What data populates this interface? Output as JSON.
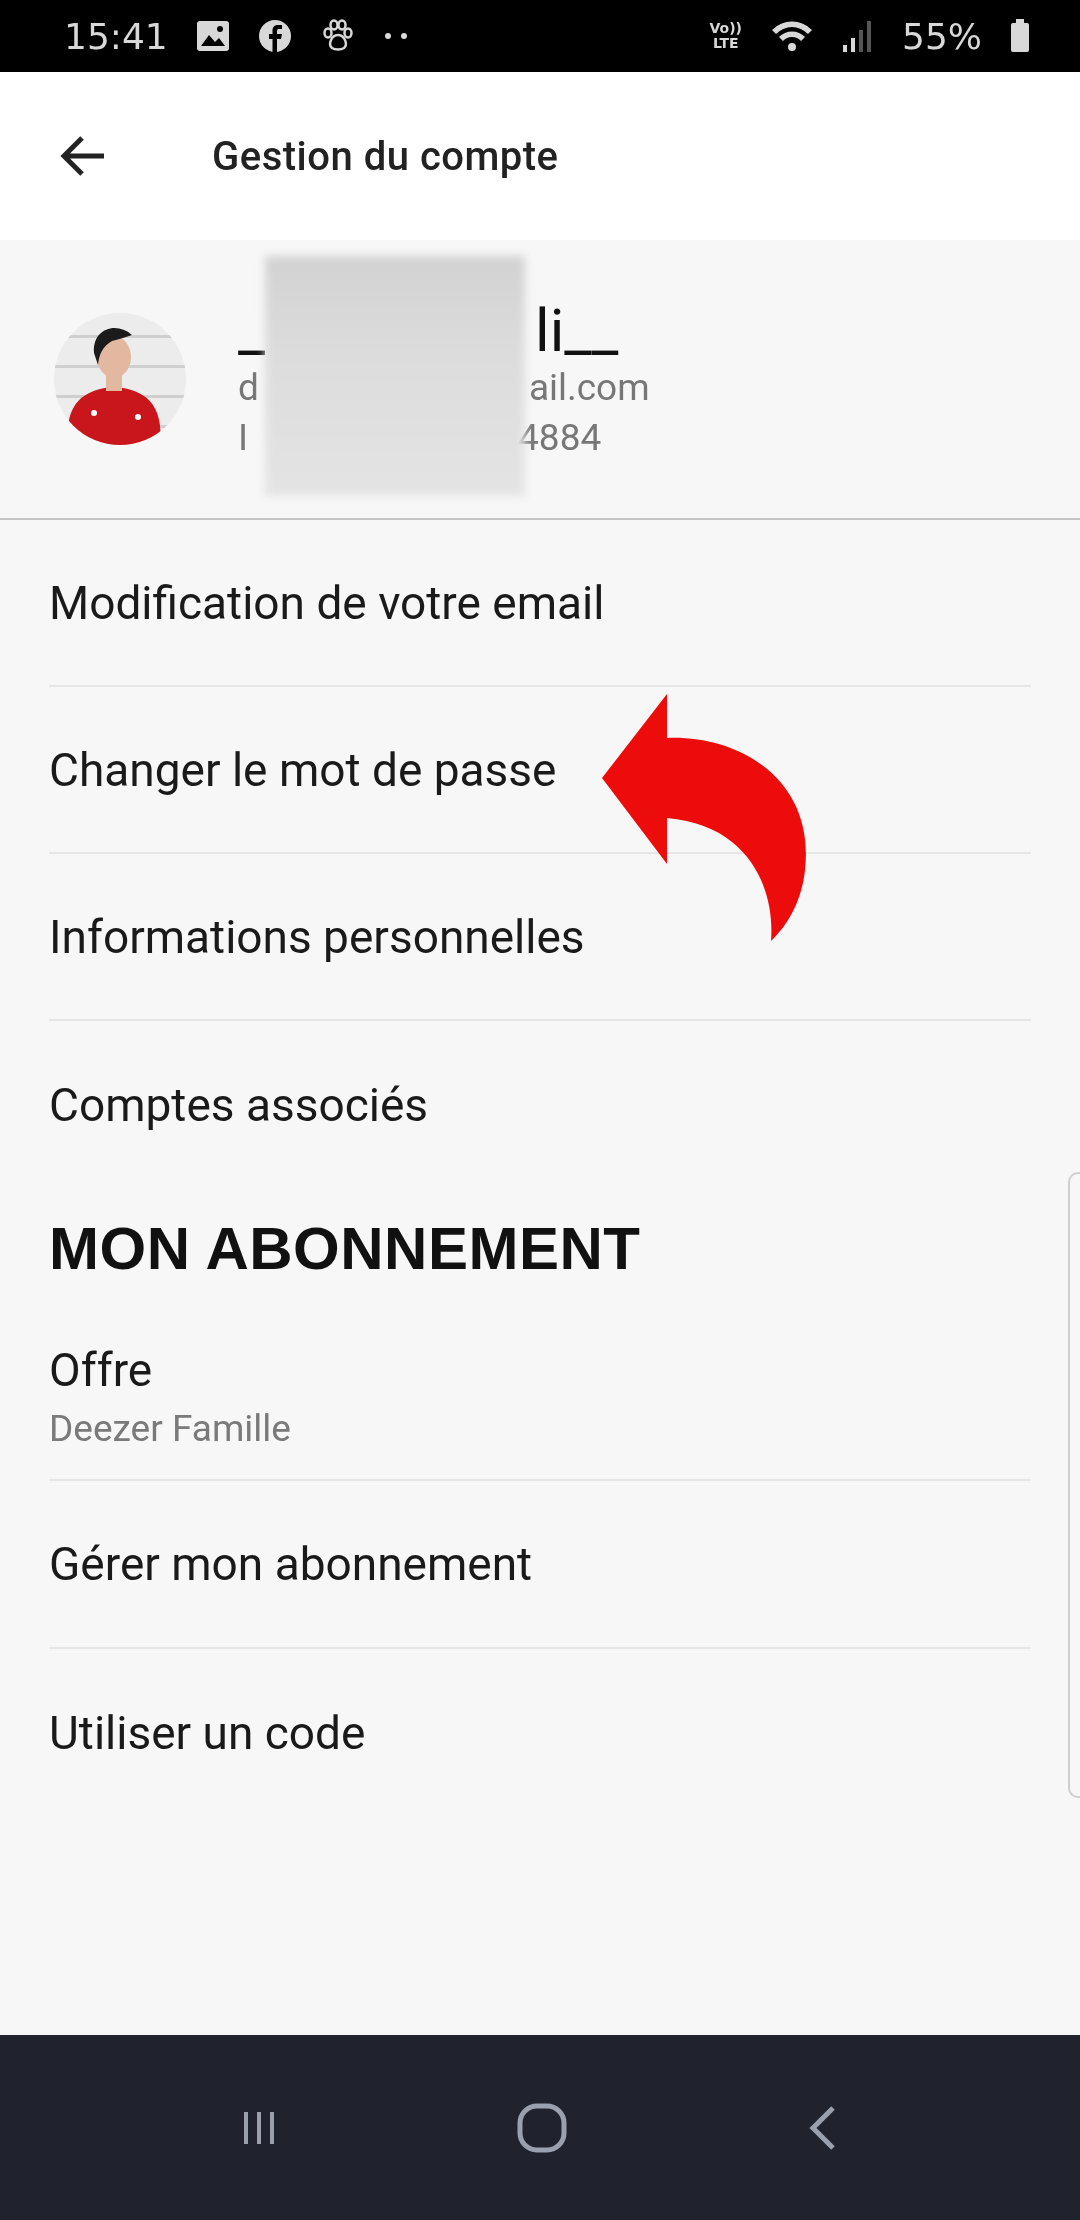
{
  "status_bar": {
    "time": "15:41",
    "network_top": "Vo))",
    "network_bottom": "LTE",
    "battery": "55%"
  },
  "app_bar": {
    "title": "Gestion du compte"
  },
  "profile": {
    "name_start": "_",
    "name_end": "li__",
    "email_start": "d",
    "email_end": "ail.com",
    "id_start": "I",
    "id_end": "4884"
  },
  "account_items": [
    {
      "label": "Modification de votre email"
    },
    {
      "label": "Changer le mot de passe"
    },
    {
      "label": "Informations personnelles"
    },
    {
      "label": "Comptes associés"
    }
  ],
  "subscription": {
    "heading": "MON ABONNEMENT",
    "items": [
      {
        "label": "Offre",
        "detail": "Deezer Famille"
      },
      {
        "label": "Gérer mon abonnement"
      },
      {
        "label": "Utiliser un code"
      }
    ]
  }
}
